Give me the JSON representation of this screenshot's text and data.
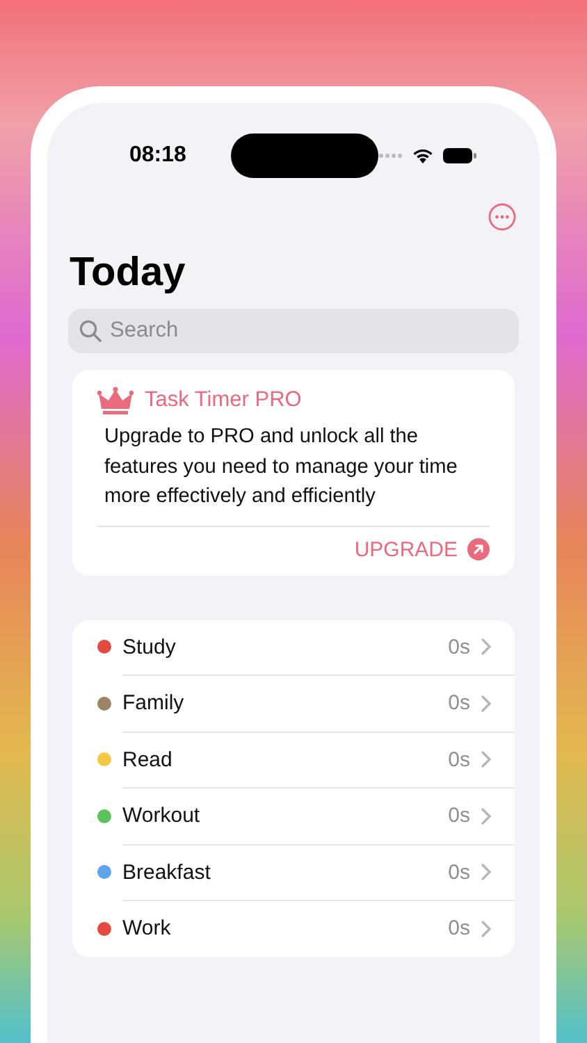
{
  "status_bar": {
    "time": "08:18"
  },
  "title": "Today",
  "search": {
    "placeholder": "Search"
  },
  "promo": {
    "title": "Task Timer PRO",
    "body": "Upgrade to PRO and unlock all the features you need to manage your time more effectively and efficiently",
    "action": "UPGRADE"
  },
  "tasks": [
    {
      "name": "Study",
      "time": "0s",
      "color": "#e5493f"
    },
    {
      "name": "Family",
      "time": "0s",
      "color": "#9c8566"
    },
    {
      "name": "Read",
      "time": "0s",
      "color": "#f4c842"
    },
    {
      "name": "Workout",
      "time": "0s",
      "color": "#5ac35a"
    },
    {
      "name": "Breakfast",
      "time": "0s",
      "color": "#5fa3ea"
    },
    {
      "name": "Work",
      "time": "0s",
      "color": "#e5493f"
    }
  ]
}
